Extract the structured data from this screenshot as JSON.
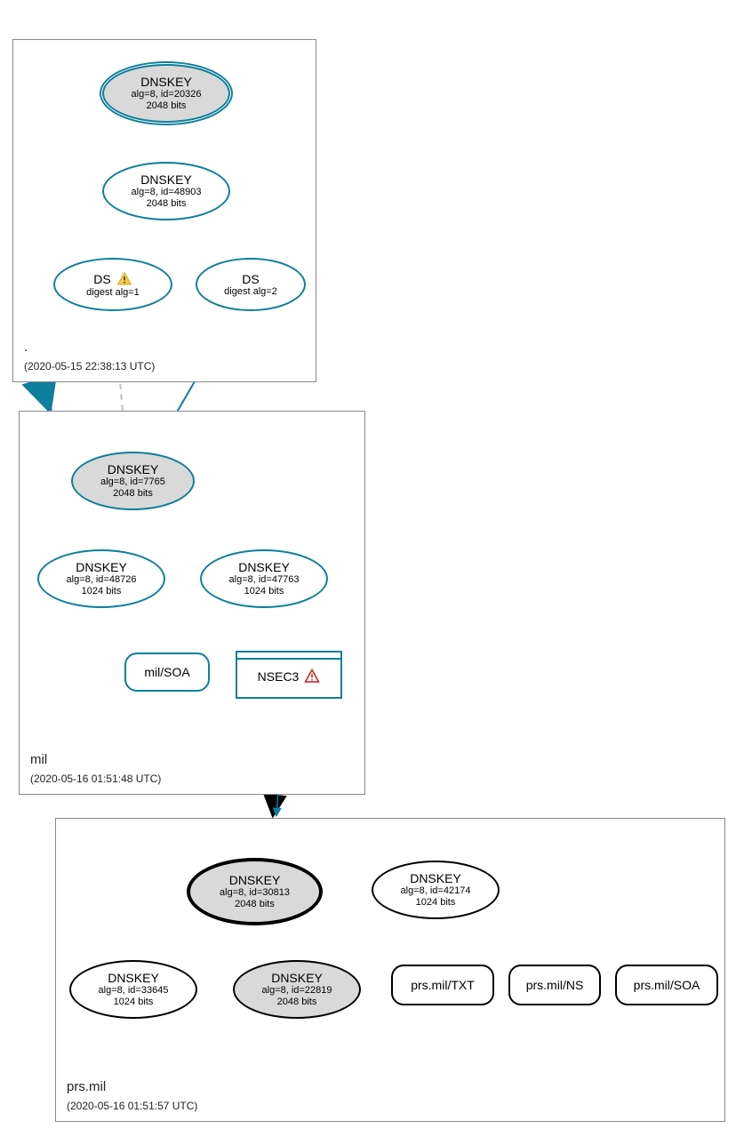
{
  "zones": {
    "root": {
      "label": ".",
      "time": "(2020-05-15 22:38:13 UTC)"
    },
    "mil": {
      "label": "mil",
      "time": "(2020-05-16 01:51:48 UTC)"
    },
    "prs": {
      "label": "prs.mil",
      "time": "(2020-05-16 01:51:57 UTC)"
    }
  },
  "nodes": {
    "rootKsk": {
      "t": "DNSKEY",
      "s1": "alg=8, id=20326",
      "s2": "2048 bits"
    },
    "rootZsk": {
      "t": "DNSKEY",
      "s1": "alg=8, id=48903",
      "s2": "2048 bits"
    },
    "ds1": {
      "t": "DS",
      "s1": "digest alg=1"
    },
    "ds2": {
      "t": "DS",
      "s1": "digest alg=2"
    },
    "milKsk": {
      "t": "DNSKEY",
      "s1": "alg=8, id=7765",
      "s2": "2048 bits"
    },
    "milZsk1": {
      "t": "DNSKEY",
      "s1": "alg=8, id=48726",
      "s2": "1024 bits"
    },
    "milZsk2": {
      "t": "DNSKEY",
      "s1": "alg=8, id=47763",
      "s2": "1024 bits"
    },
    "milSoa": "mil/SOA",
    "nsec3": "NSEC3",
    "prsKsk": {
      "t": "DNSKEY",
      "s1": "alg=8, id=30813",
      "s2": "2048 bits"
    },
    "prsZsk42174": {
      "t": "DNSKEY",
      "s1": "alg=8, id=42174",
      "s2": "1024 bits"
    },
    "prsKey33645": {
      "t": "DNSKEY",
      "s1": "alg=8, id=33645",
      "s2": "1024 bits"
    },
    "prsKey22819": {
      "t": "DNSKEY",
      "s1": "alg=8, id=22819",
      "s2": "2048 bits"
    },
    "prsTxt": "prs.mil/TXT",
    "prsNs": "prs.mil/NS",
    "prsSoa": "prs.mil/SOA"
  },
  "chart_data": {
    "type": "graph",
    "nodes": [
      {
        "id": "rootKsk",
        "zone": ".",
        "label": "DNSKEY alg=8 id=20326 2048 bits",
        "ksk": true
      },
      {
        "id": "rootZsk",
        "zone": ".",
        "label": "DNSKEY alg=8 id=48903 2048 bits"
      },
      {
        "id": "ds1",
        "zone": ".",
        "label": "DS digest alg=1",
        "warn": true
      },
      {
        "id": "ds2",
        "zone": ".",
        "label": "DS digest alg=2"
      },
      {
        "id": "milKsk",
        "zone": "mil",
        "label": "DNSKEY alg=8 id=7765 2048 bits",
        "ksk": true
      },
      {
        "id": "milZsk1",
        "zone": "mil",
        "label": "DNSKEY alg=8 id=48726 1024 bits"
      },
      {
        "id": "milZsk2",
        "zone": "mil",
        "label": "DNSKEY alg=8 id=47763 1024 bits"
      },
      {
        "id": "milSoa",
        "zone": "mil",
        "label": "mil/SOA"
      },
      {
        "id": "nsec3",
        "zone": "mil",
        "label": "NSEC3",
        "error": true
      },
      {
        "id": "prsKsk",
        "zone": "prs.mil",
        "label": "DNSKEY alg=8 id=30813 2048 bits",
        "ksk": true
      },
      {
        "id": "prsZsk42174",
        "zone": "prs.mil",
        "label": "DNSKEY alg=8 id=42174 1024 bits"
      },
      {
        "id": "prsKey33645",
        "zone": "prs.mil",
        "label": "DNSKEY alg=8 id=33645 1024 bits"
      },
      {
        "id": "prsKey22819",
        "zone": "prs.mil",
        "label": "DNSKEY alg=8 id=22819 2048 bits"
      },
      {
        "id": "prsTxt",
        "zone": "prs.mil",
        "label": "prs.mil/TXT"
      },
      {
        "id": "prsNs",
        "zone": "prs.mil",
        "label": "prs.mil/NS"
      },
      {
        "id": "prsSoa",
        "zone": "prs.mil",
        "label": "prs.mil/SOA"
      }
    ],
    "edges": [
      {
        "from": "rootKsk",
        "to": "rootKsk",
        "self": true
      },
      {
        "from": "rootKsk",
        "to": "rootZsk"
      },
      {
        "from": "rootZsk",
        "to": "ds1"
      },
      {
        "from": "rootZsk",
        "to": "ds2"
      },
      {
        "from": "ds1",
        "to": "milKsk",
        "style": "dashed-gray"
      },
      {
        "from": "ds2",
        "to": "milKsk"
      },
      {
        "from": "milKsk",
        "to": "milKsk",
        "self": true
      },
      {
        "from": "milKsk",
        "to": "milZsk1"
      },
      {
        "from": "milKsk",
        "to": "milZsk2"
      },
      {
        "from": "milZsk2",
        "to": "milZsk2",
        "self": true
      },
      {
        "from": "milZsk2",
        "to": "milSoa"
      },
      {
        "from": "milZsk2",
        "to": "nsec3"
      },
      {
        "from": "nsec3",
        "to": "prsKsk",
        "style": "black"
      },
      {
        "from": "prsKsk",
        "to": "prsKsk",
        "self": true
      },
      {
        "from": "prsZsk42174",
        "to": "prsZsk42174",
        "self": true
      },
      {
        "from": "prsKsk",
        "to": "prsKey33645"
      },
      {
        "from": "prsKsk",
        "to": "prsKey22819"
      },
      {
        "from": "prsKsk",
        "to": "prsZsk42174"
      },
      {
        "from": "prsZsk42174",
        "to": "prsKey33645"
      },
      {
        "from": "prsZsk42174",
        "to": "prsKey22819"
      },
      {
        "from": "prsZsk42174",
        "to": "prsTxt"
      },
      {
        "from": "prsZsk42174",
        "to": "prsNs"
      },
      {
        "from": "prsZsk42174",
        "to": "prsSoa"
      }
    ]
  }
}
